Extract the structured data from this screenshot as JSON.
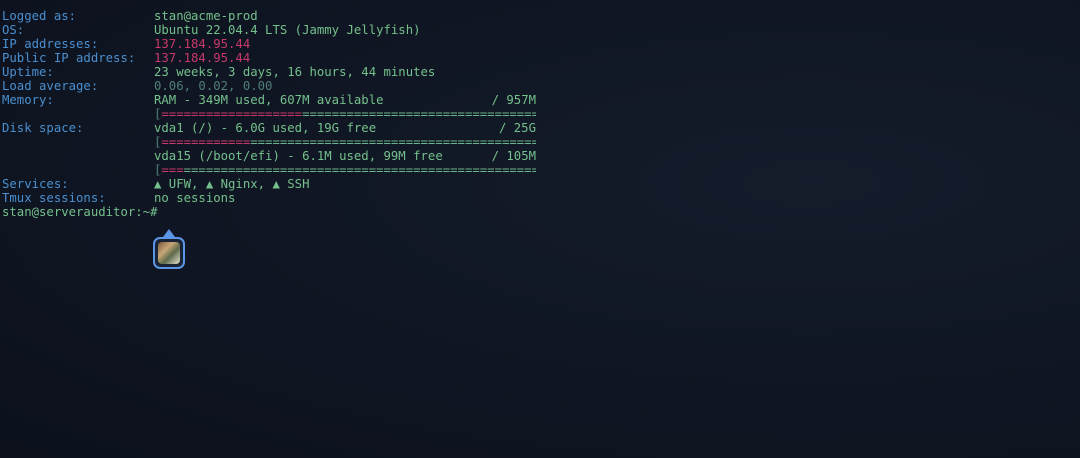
{
  "info": {
    "logged_as": {
      "label": "Logged as:",
      "value": "stan@acme-prod"
    },
    "os": {
      "label": "OS:",
      "value": "Ubuntu 22.04.4 LTS (Jammy Jellyfish)"
    },
    "ip": {
      "label": "IP addresses:",
      "value": "137.184.95.44"
    },
    "public_ip": {
      "label": "Public IP address:",
      "value": "137.184.95.44"
    },
    "uptime": {
      "label": "Uptime:",
      "value": "23 weeks, 3 days, 16 hours, 44 minutes"
    },
    "load": {
      "label": "Load average:",
      "value": "0.06, 0.02, 0.00"
    },
    "memory": {
      "label": "Memory:",
      "text": "RAM - 349M used, 607M available",
      "total": "/ 957M",
      "used_fraction": 0.365
    },
    "disk": {
      "label": "Disk space:",
      "vda1": {
        "text": "vda1 (/) - 6.0G used, 19G free",
        "total": "/ 25G",
        "used_fraction": 0.24
      },
      "vda15": {
        "text": "vda15 (/boot/efi) - 6.1M used, 99M free",
        "total": "/ 105M",
        "used_fraction": 0.06
      }
    },
    "services": {
      "label": "Services:",
      "value": "▲ UFW, ▲ Nginx, ▲ SSH"
    },
    "tmux": {
      "label": "Tmux sessions:",
      "value": "no sessions"
    }
  },
  "prompt": {
    "text": "stan@serverauditor:~#"
  },
  "colors": {
    "background": "#0f1522",
    "label": "#4a8fcf",
    "value": "#74c08c",
    "ip": "#c8386a",
    "bar_used": "#c8386a",
    "bar_free": "#6fb58c",
    "accent": "#5b95e6"
  },
  "icons": {
    "collaborator": "user-avatar-icon"
  }
}
